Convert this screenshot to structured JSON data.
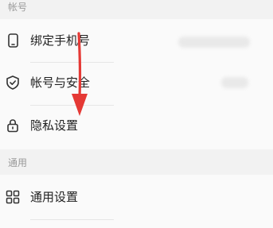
{
  "section_account": {
    "title": "帐号"
  },
  "rows": [
    {
      "label": "绑定手机号",
      "icon": "phone-icon"
    },
    {
      "label": "帐号与安全",
      "icon": "shield-check-icon"
    },
    {
      "label": "隐私设置",
      "icon": "lock-icon"
    }
  ],
  "section_general": {
    "title": "通用"
  },
  "general_rows": [
    {
      "label": "通用设置",
      "icon": "grid-icon"
    }
  ],
  "colors": {
    "arrow": "#e53935",
    "background": "#f2f2f2",
    "card": "#fafafa"
  }
}
